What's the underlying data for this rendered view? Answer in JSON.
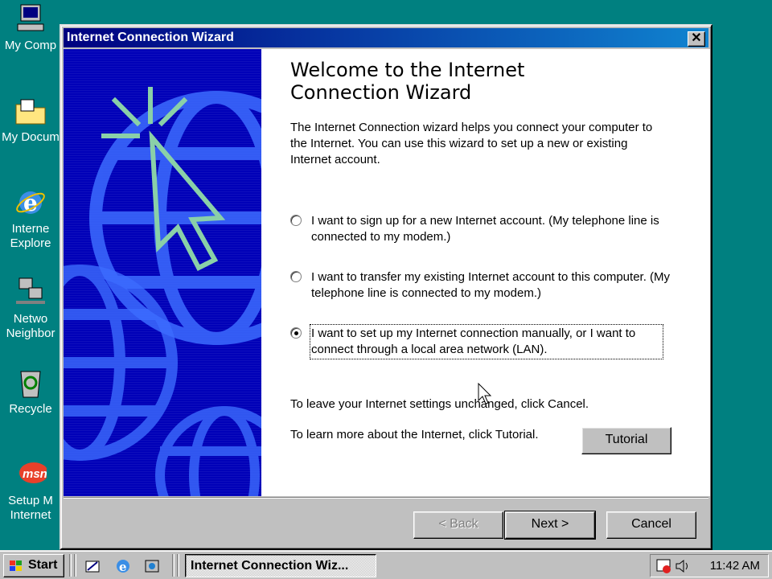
{
  "desktop": {
    "icons": [
      {
        "label": "My Comp",
        "icon": "my-computer-icon"
      },
      {
        "label": "My Docum",
        "icon": "my-documents-icon"
      },
      {
        "label": "Interne\nExplore",
        "icon": "internet-explorer-icon"
      },
      {
        "label": "Netwo\nNeighbor",
        "icon": "network-neighborhood-icon"
      },
      {
        "label": "Recycle",
        "icon": "recycle-bin-icon"
      },
      {
        "label": "Setup M\nInternet",
        "icon": "msn-icon"
      }
    ]
  },
  "window": {
    "title": "Internet Connection Wizard",
    "heading": "Welcome to the Internet Connection Wizard",
    "intro": "The Internet Connection wizard helps you connect your computer to the Internet.  You can use this wizard to set up a new or existing Internet account.",
    "options": [
      {
        "label": "I want to sign up for a new Internet account. (My telephone line is connected to my modem.)",
        "checked": false
      },
      {
        "label": "I want to transfer my existing Internet account to this computer. (My telephone line is connected to my modem.)",
        "checked": false
      },
      {
        "label": "I want to set up my Internet connection manually, or I want to connect through a local area network (LAN).",
        "checked": true
      }
    ],
    "cancel_note": "To leave your Internet settings unchanged, click Cancel.",
    "tutorial_note": "To learn more about the Internet, click Tutorial.",
    "buttons": {
      "tutorial": "Tutorial",
      "back": "< Back",
      "next": "Next >",
      "cancel": "Cancel"
    }
  },
  "taskbar": {
    "start": "Start",
    "task": "Internet Connection Wiz...",
    "clock": "11:42 AM"
  }
}
